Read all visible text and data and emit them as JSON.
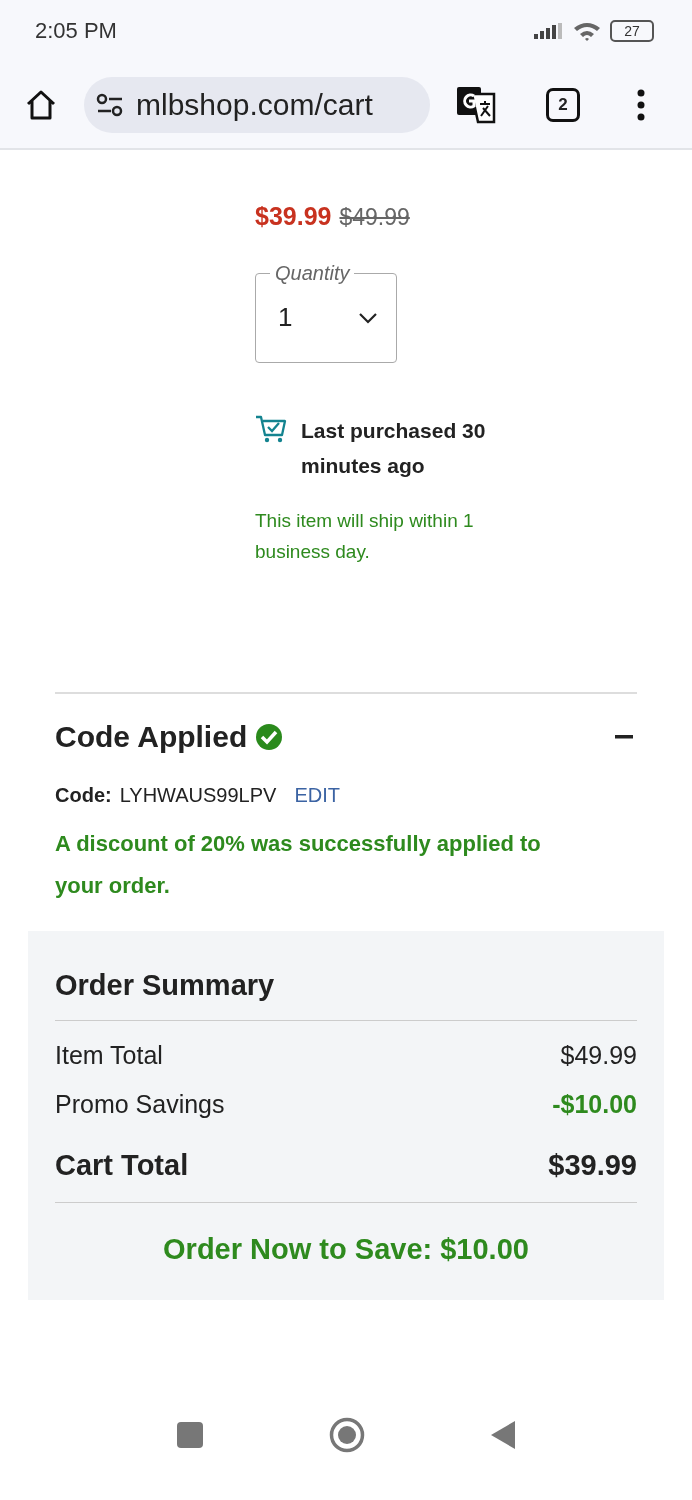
{
  "status_bar": {
    "time": "2:05 PM",
    "battery": "27"
  },
  "browser": {
    "url": "mlbshop.com/cart",
    "tab_count": "2"
  },
  "product": {
    "sale_price": "$39.99",
    "original_price": "$49.99",
    "quantity": {
      "label": "Quantity",
      "value": "1"
    },
    "last_purchased": "Last purchased 30 minutes ago",
    "shipping": "This item will ship within 1 business day."
  },
  "promo": {
    "title": "Code Applied",
    "expanded": true,
    "code_label": "Code:",
    "code": "LYHWAUS99LPV",
    "edit": "EDIT",
    "message": "A discount of 20% was successfully applied to your order."
  },
  "order_summary": {
    "title": "Order Summary",
    "rows": [
      {
        "label": "Item Total",
        "value": "$49.99",
        "kind": "line"
      },
      {
        "label": "Promo Savings",
        "value": "-$10.00",
        "kind": "savings"
      },
      {
        "label": "Cart Total",
        "value": "$39.99",
        "kind": "total"
      }
    ],
    "save_message": "Order Now to Save: $10.00"
  }
}
